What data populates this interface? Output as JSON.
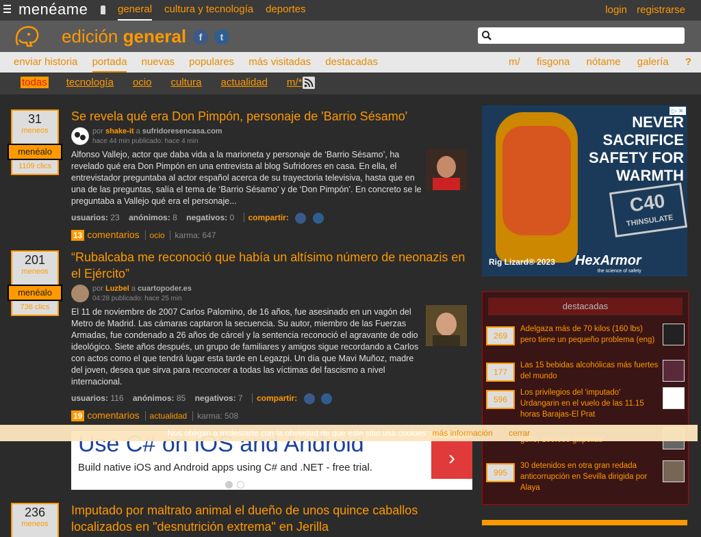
{
  "top": {
    "logo": "menéame",
    "tabs": [
      "general",
      "cultura y tecnología",
      "deportes"
    ],
    "login": "login",
    "register": "registrarse"
  },
  "header": {
    "title_prefix": "edición",
    "title_bold": "general",
    "facebook_letter": "f",
    "twitter_letter": "t",
    "search_placeholder": ""
  },
  "nav": {
    "left": [
      "enviar historia",
      "portada",
      "nuevas",
      "populares",
      "más visitadas",
      "destacadas"
    ],
    "right": [
      "m/",
      "fisgona",
      "nótame",
      "galería",
      "?"
    ]
  },
  "subnav": [
    "todas",
    "tecnología",
    "ocio",
    "cultura",
    "actualidad",
    "m/*"
  ],
  "stories": [
    {
      "votes": "31",
      "votes_label": "meneos",
      "button": "menéalo",
      "clicks": "1109 clics",
      "title": "Se revela qué era Don Pimpón, personaje de 'Barrio Sésamo'",
      "by_label": "por",
      "author": "shake-it",
      "at": "a",
      "site": "sufridoresencasa.com",
      "time": "hace 44 min publicado: hace 4 min",
      "body": "Alfonso Vallejo, actor que daba vida a la marioneta y personaje de ‘Barrio Sésamo’, ha revelado qué era Don Pimpón en una entrevista al blog Sufridores en casa. En ella, el entrevistador preguntaba al actor español acerca de su trayectoria televisiva, hasta que en una de las preguntas, salía el tema de ‘Barrio Sésamo’ y de ‘Don Pimpón’. En concreto se le preguntaba a Vallejo qué era el personaje...",
      "usuarios_label": "usuarios:",
      "usuarios": "23",
      "anon_label": "anónimos:",
      "anon": "8",
      "neg_label": "negativos:",
      "neg": "0",
      "share": "compartir:",
      "comments_n": "13",
      "comments_label": "comentarios",
      "tag": "ocio",
      "karma": "karma: 647"
    },
    {
      "votes": "201",
      "votes_label": "meneos",
      "button": "menéalo",
      "clicks": "736 clics",
      "title": "“Rubalcaba me reconoció que había un altísimo número de neonazis en el Ejército”",
      "by_label": "por",
      "author": "Luzbel",
      "at": "a",
      "site": "cuartopoder.es",
      "time": "04:28 publicado: hace 25 min",
      "body": "El 11 de noviembre de 2007 Carlos Palomino, de 16 años, fue asesinado en un vagón del Metro de Madrid. Las cámaras captaron la secuencia. Su autor, miembro de las Fuerzas Armadas, fue condenado a 26 años de cárcel y la sentencia reconoció el agravante de odio ideológico. Siete años después, un grupo de familiares y amigos sigue recordando a Carlos con actos como el que tendrá lugar esta tarde en Legazpi. Un día que Mavi Muñoz, madre del joven, desea que sirva para reconocer a todas las víctimas del fascismo a nivel internacional.",
      "usuarios_label": "usuarios:",
      "usuarios": "116",
      "anon_label": "anónimos:",
      "anon": "85",
      "neg_label": "negativos:",
      "neg": "7",
      "share": "compartir:",
      "comments_n": "19",
      "comments_label": "comentarios",
      "tag": "actualidad",
      "karma": "karma: 508"
    },
    {
      "votes": "236",
      "votes_label": "meneos",
      "title": "Imputado por maltrato animal el dueño de unos quince caballos localizados en \"desnutrición extrema\" en Jerilla"
    }
  ],
  "ad": {
    "headline": "NEVER SACRIFICE SAFETY FOR WARMTH",
    "badge": "C40",
    "badge_sub": "THINSULATE",
    "product": "Rig Lizard® 2023",
    "brand": "HexArmor",
    "brand_sub": "the science of safety"
  },
  "destacadas": {
    "title": "destacadas",
    "items": [
      {
        "count": "269",
        "text": "Adelgaza más de 70 kilos (160 lbs) pero tiene un pequeño problema (eng)"
      },
      {
        "count": "177",
        "text": "Las 15 bebidas alcohólicas más fuertes del mundo"
      },
      {
        "count": "596",
        "text": "Los privilegios del 'imputado' Urdangarin en el vuelo de las 11.15 horas Barajas-El Prat"
      },
      {
        "count": "",
        "text": "golfo, 100.000 gilipollas\""
      },
      {
        "count": "995",
        "text": "30 detenidos en otra gran redada anticorrupción en Sevilla dirigida por Alaya"
      }
    ]
  },
  "cookie": {
    "text": "Nos obligan a molestarte con la obviedad de que este sitio usa cookies",
    "more": "más información",
    "close": "cerrar"
  },
  "bottom_ad": {
    "headline": "Use C# on iOS and Android",
    "sub": "Build native iOS and Android apps using C# and .NET - free trial.",
    "arrow": "›"
  }
}
